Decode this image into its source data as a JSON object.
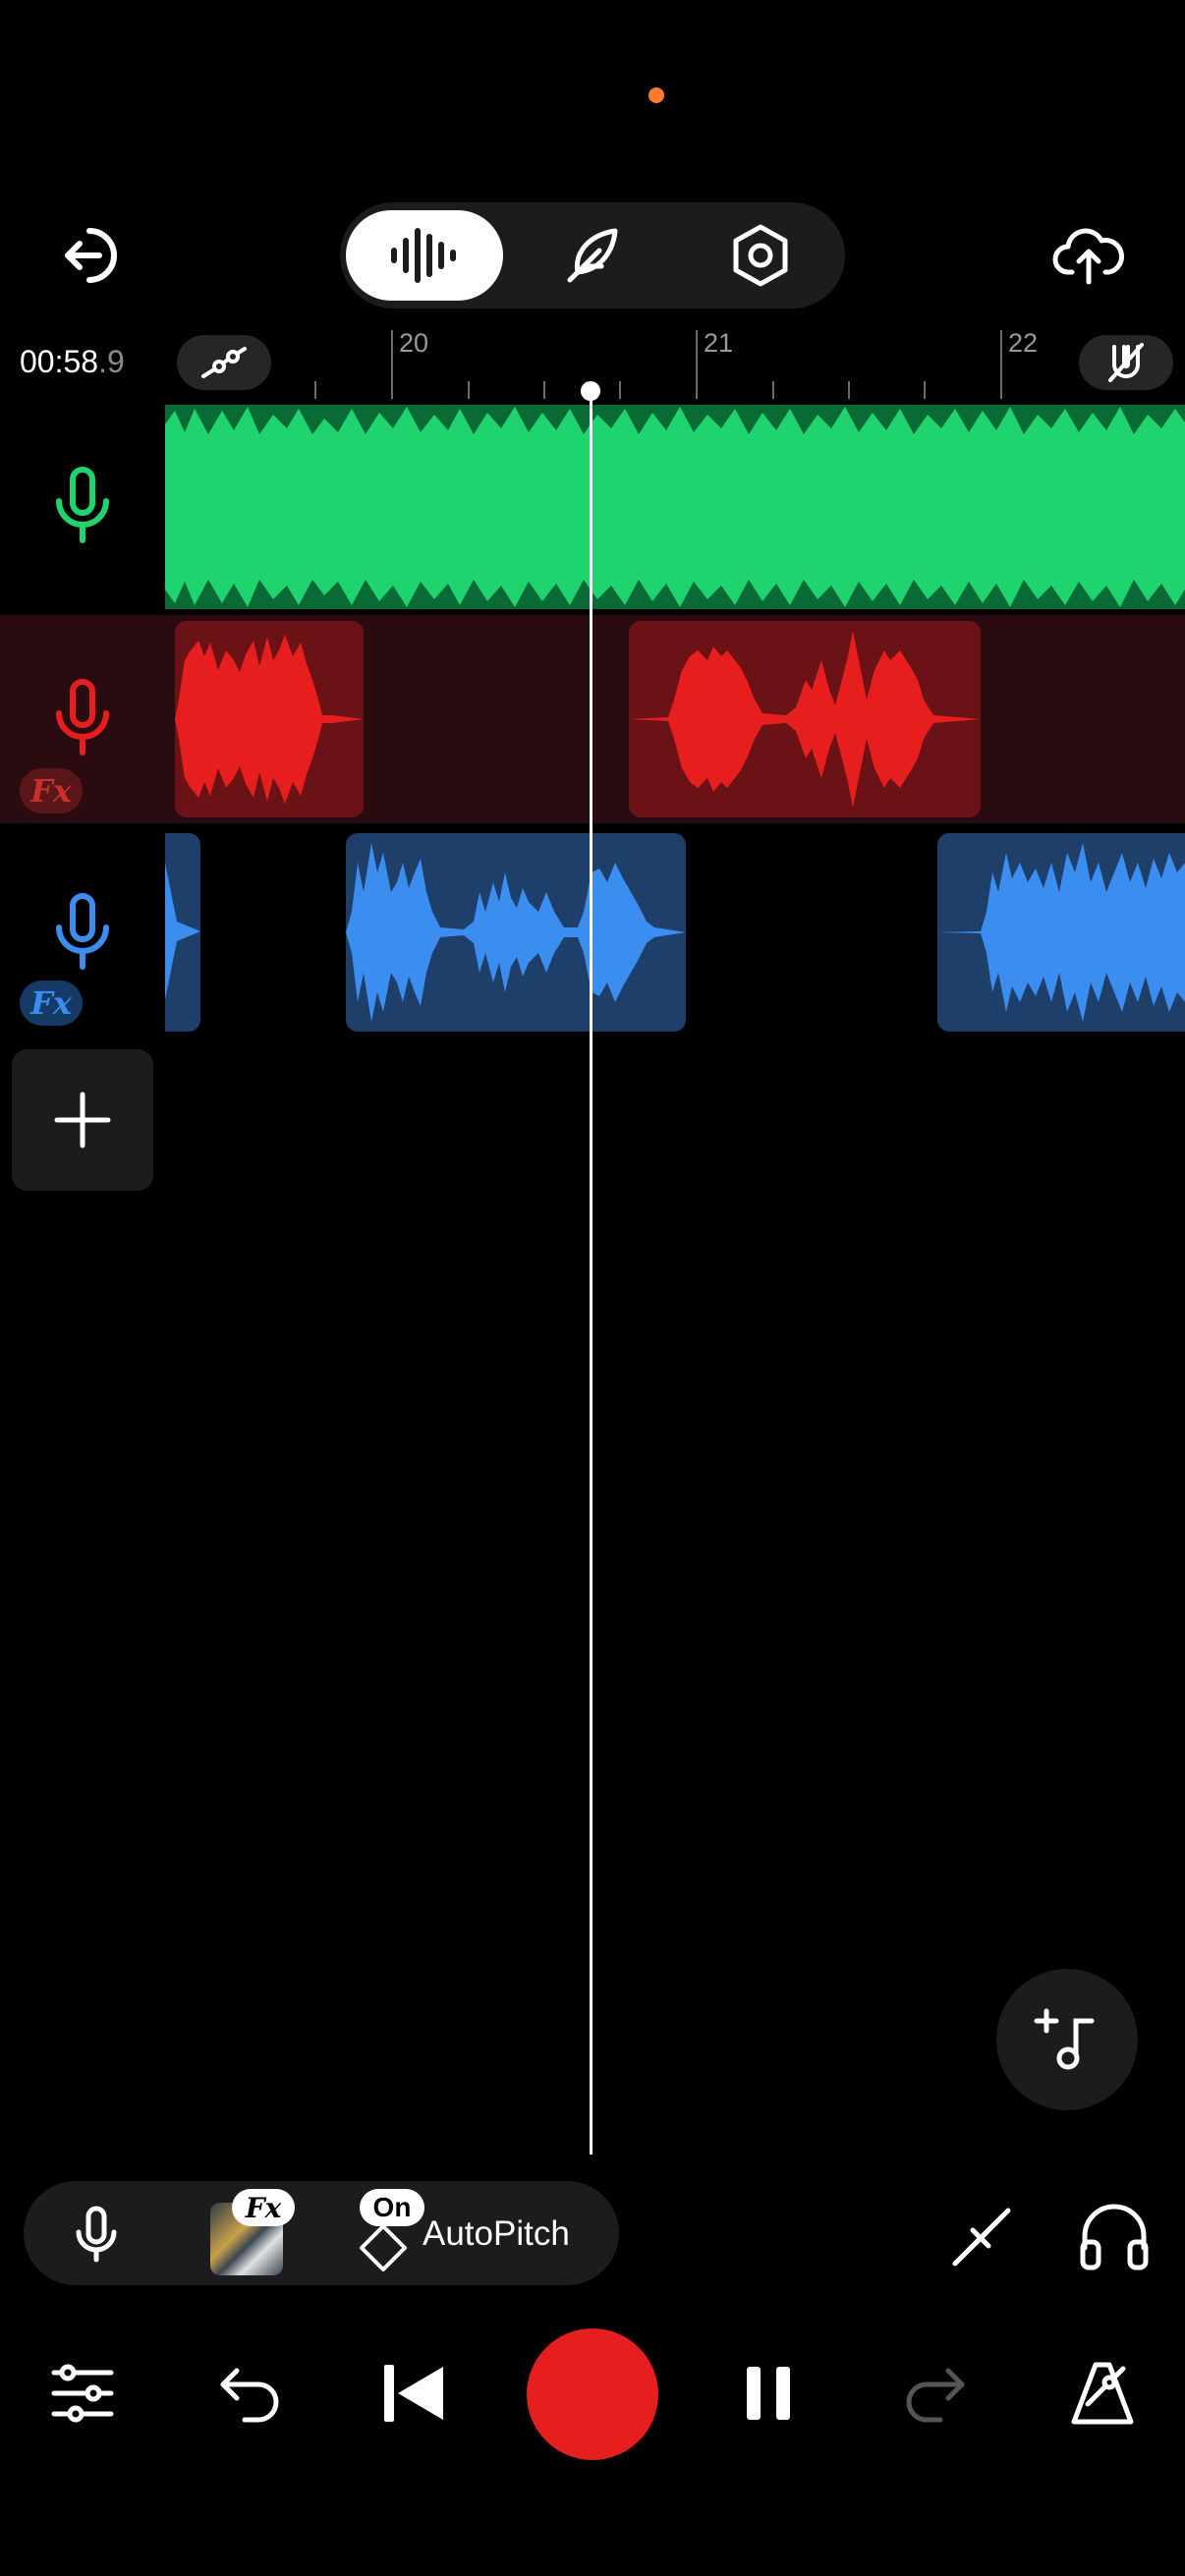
{
  "header": {
    "exit_icon": "exit-icon",
    "modes": [
      {
        "icon": "waveform-icon",
        "active": true
      },
      {
        "icon": "feather-icon",
        "active": false
      },
      {
        "icon": "hex-settings-icon",
        "active": false
      }
    ],
    "cloud_icon": "cloud-upload-icon"
  },
  "timeline": {
    "time_main": "00:58",
    "time_fraction": ".9",
    "bar_numbers": [
      "20",
      "21",
      "22"
    ]
  },
  "tracks": [
    {
      "color": "#1fd36e",
      "icon": "microphone-icon",
      "fx": false
    },
    {
      "color": "#e61e1e",
      "icon": "microphone-icon",
      "fx": true,
      "fx_label": "Fx"
    },
    {
      "color": "#3b8df0",
      "icon": "microphone-icon",
      "fx": true,
      "fx_label": "Fx"
    }
  ],
  "bottom_bar": {
    "fx_badge": "Fx",
    "on_badge": "On",
    "autopitch_label": "AutoPitch"
  },
  "colors": {
    "green": "#1fd36e",
    "red": "#e61e1e",
    "blue": "#3b8df0",
    "record": "#e61e1e",
    "accent_dot": "#ff7a2f"
  }
}
